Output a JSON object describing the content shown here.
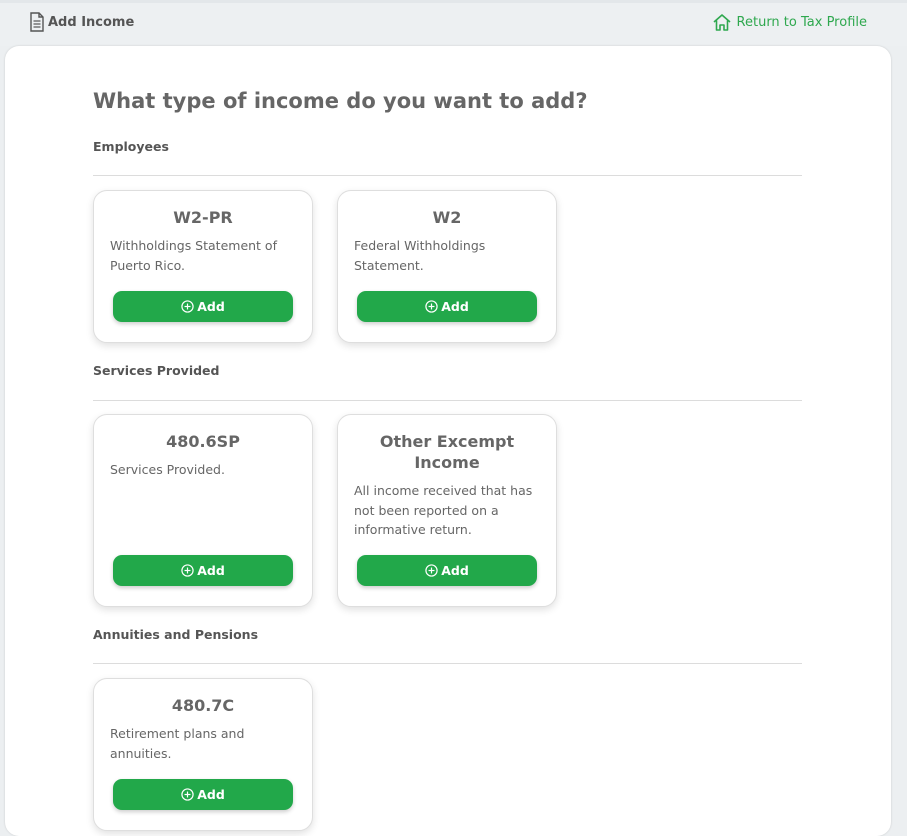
{
  "header": {
    "title": "Add Income",
    "title_icon": "document-icon",
    "return_link": "Return to Tax Profile",
    "return_icon": "home-icon"
  },
  "main": {
    "heading": "What type of income do you want to add?",
    "sections": [
      {
        "label": "Employees",
        "cards": [
          {
            "title": "W2-PR",
            "description": "Withholdings Statement of Puerto Rico.",
            "button": "Add"
          },
          {
            "title": "W2",
            "description": "Federal Withholdings Statement.",
            "button": "Add"
          }
        ]
      },
      {
        "label": "Services Provided",
        "cards": [
          {
            "title": "480.6SP",
            "description": "Services Provided.",
            "button": "Add"
          },
          {
            "title": "Other Excempt Income",
            "description": "All income received that has not been reported on a informative return.",
            "button": "Add"
          }
        ]
      },
      {
        "label": "Annuities and Pensions",
        "cards": [
          {
            "title": "480.7C",
            "description": "Retirement plans and annuities.",
            "button": "Add"
          }
        ]
      }
    ]
  },
  "colors": {
    "accent_green": "#22a84a",
    "link_green": "#2fa84f"
  }
}
